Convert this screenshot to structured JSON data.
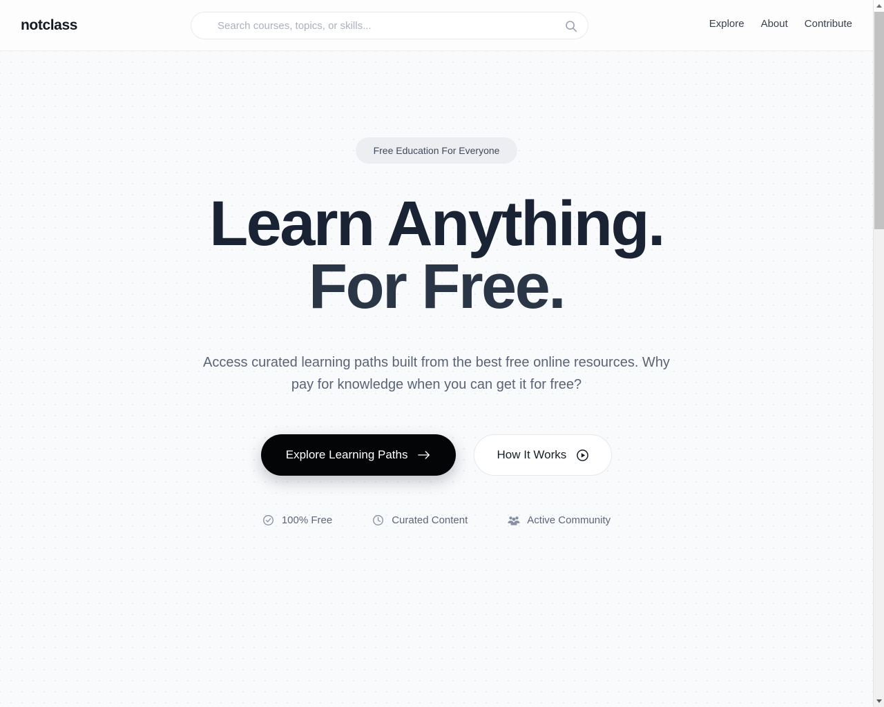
{
  "header": {
    "logo": "notclass",
    "search": {
      "placeholder": "Search courses, topics, or skills...",
      "value": "",
      "icon": "search-icon"
    },
    "nav": [
      {
        "label": "Explore"
      },
      {
        "label": "About"
      },
      {
        "label": "Contribute"
      }
    ]
  },
  "hero": {
    "badge": "Free Education For Everyone",
    "headline_line1": "Learn Anything.",
    "headline_line2": "For Free.",
    "subtitle": "Access curated learning paths built from the best free online resources. Why pay for knowledge when you can get it for free?",
    "cta": {
      "primary": {
        "label": "Explore Learning Paths",
        "icon": "arrow-right-icon"
      },
      "secondary": {
        "label": "How It Works",
        "icon": "play-circle-icon"
      }
    },
    "features": [
      {
        "label": "100% Free",
        "icon": "check-circle-icon"
      },
      {
        "label": "Curated Content",
        "icon": "clock-icon"
      },
      {
        "label": "Active Community",
        "icon": "users-group-icon"
      }
    ]
  },
  "colors": {
    "headline": "#1a2333",
    "primary_button_bg": "#030507",
    "hero_bg": "#f8fafc",
    "dot_pattern": "#e3e7ed",
    "badge_bg": "#eceef1",
    "muted_text": "#5a6475"
  },
  "scrollbar": {
    "up_arrow": "scroll-up-arrow",
    "down_arrow": "scroll-down-arrow"
  }
}
